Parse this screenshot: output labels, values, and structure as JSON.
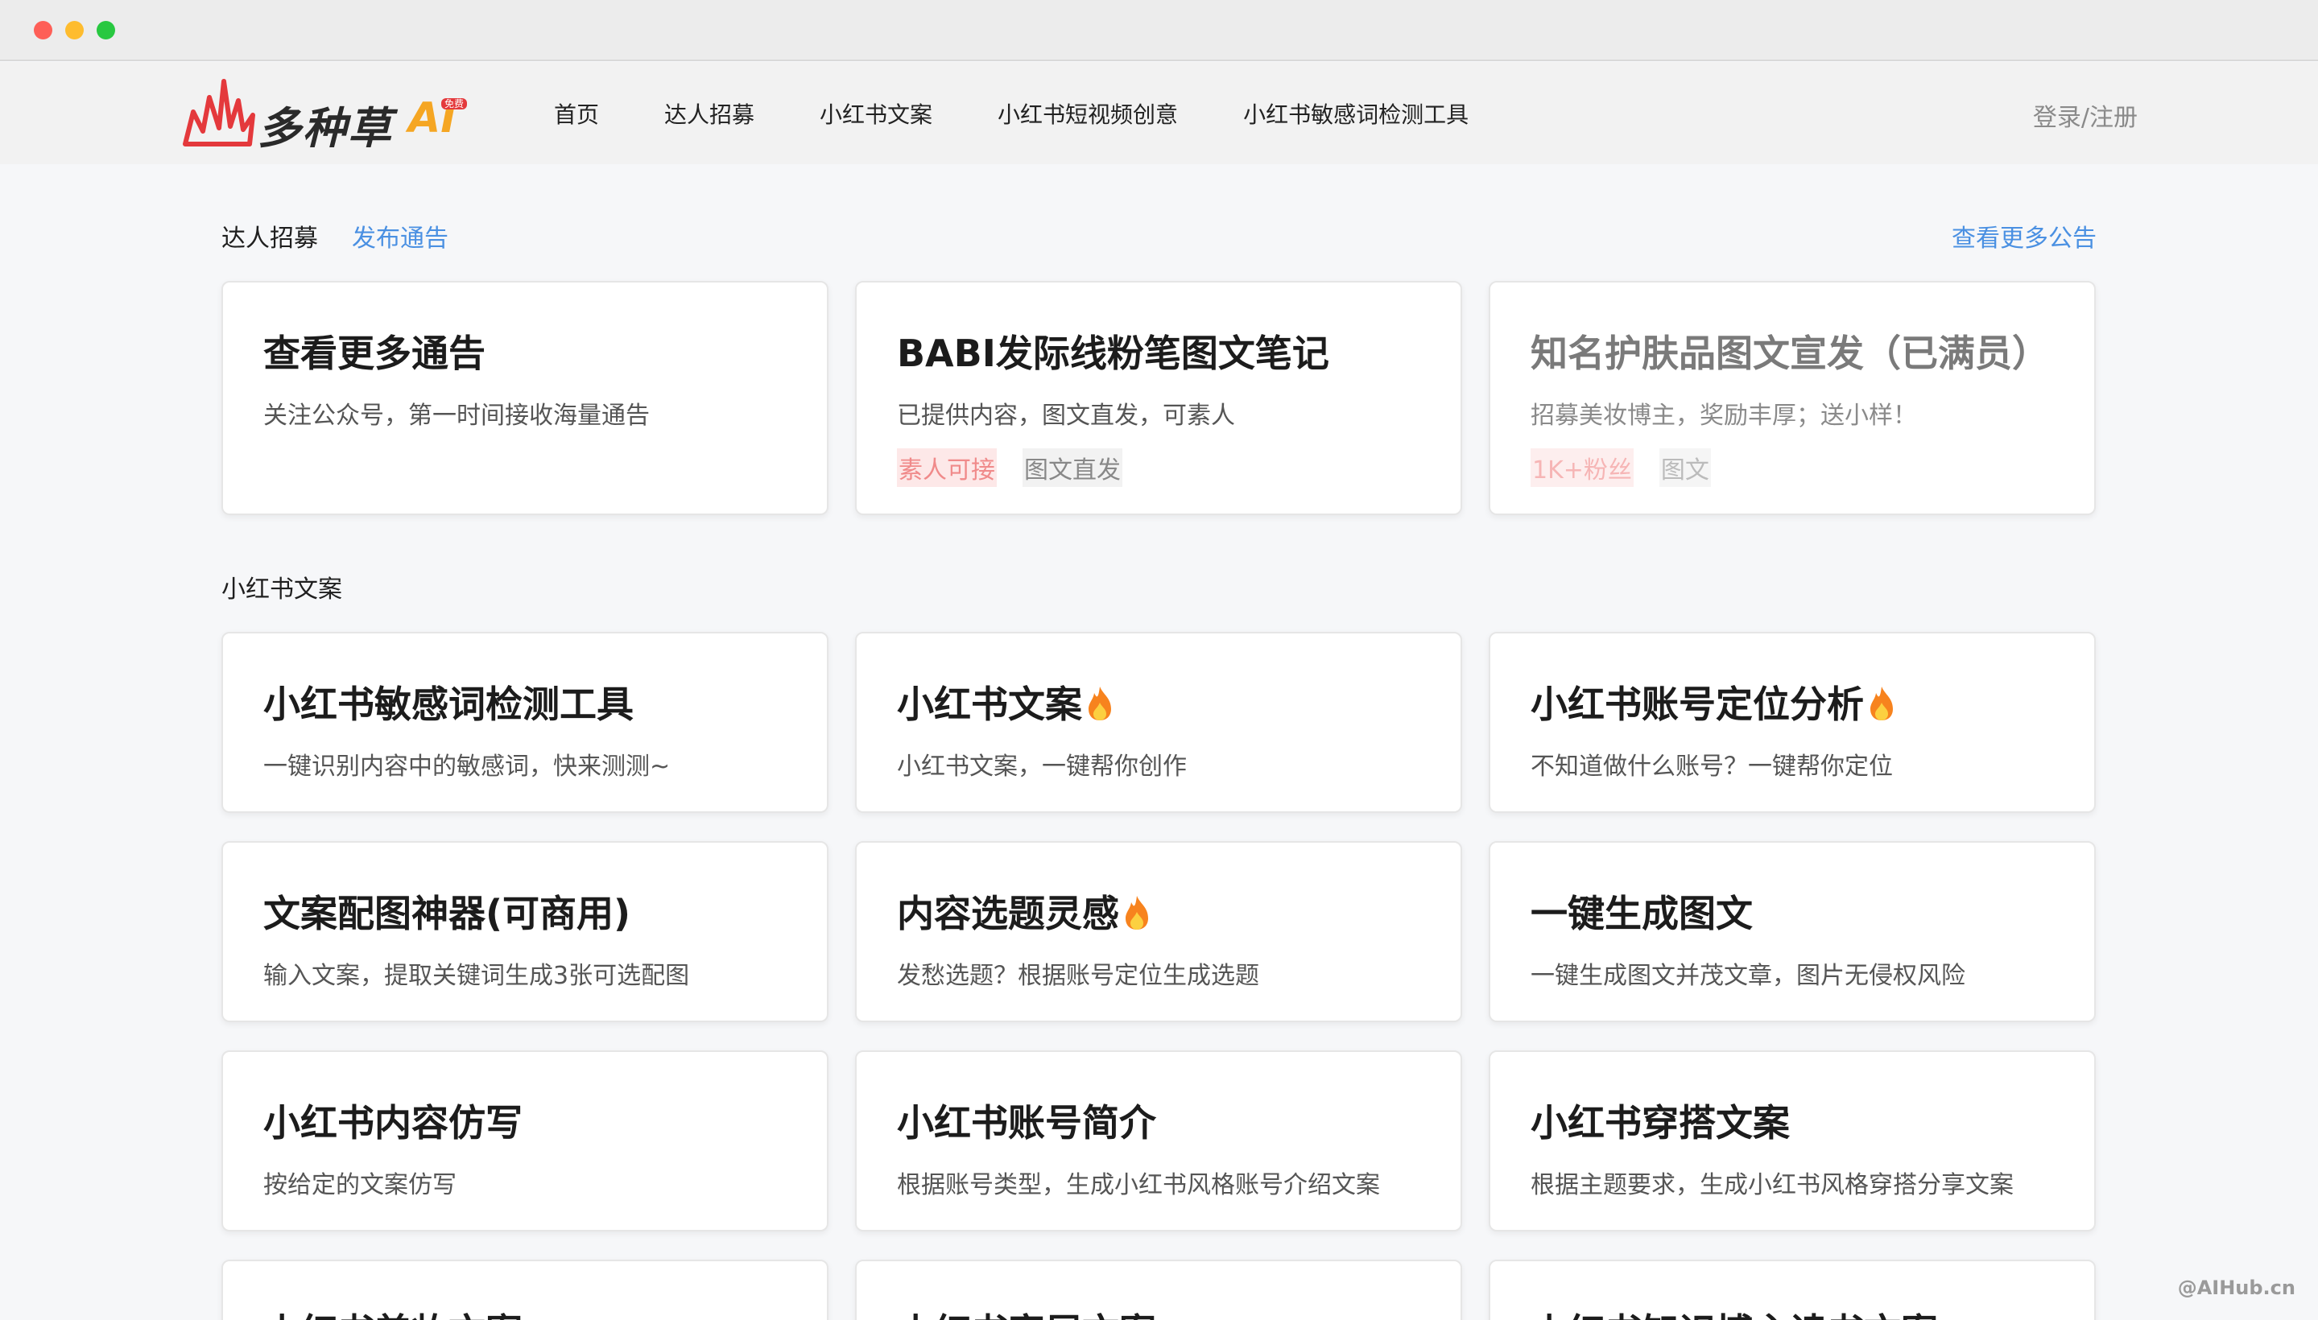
{
  "header": {
    "logo_text": "多种草",
    "logo_ai": "AI",
    "logo_badge": "免费",
    "nav": [
      "首页",
      "达人招募",
      "小红书文案",
      "小红书短视频创意",
      "小红书敏感词检测工具"
    ],
    "login": "登录/注册"
  },
  "recruit": {
    "title": "达人招募",
    "publish_link": "发布通告",
    "more_link": "查看更多公告",
    "cards": [
      {
        "title": "查看更多通告",
        "desc": "关注公众号，第一时间接收海量通告",
        "tags": []
      },
      {
        "title": "BABI发际线粉笔图文笔记",
        "desc": "已提供内容，图文直发，可素人",
        "tags": [
          "素人可接",
          "图文直发"
        ]
      },
      {
        "title": "知名护肤品图文宣发（已满员）",
        "desc": "招募美妆博主，奖励丰厚；送小样！",
        "tags": [
          "1K+粉丝",
          "图文"
        ]
      }
    ]
  },
  "copy": {
    "title": "小红书文案",
    "cards": [
      {
        "title": "小红书敏感词检测工具",
        "desc": "一键识别内容中的敏感词，快来测测~",
        "hot": false
      },
      {
        "title": "小红书文案",
        "desc": "小红书文案，一键帮你创作",
        "hot": true
      },
      {
        "title": "小红书账号定位分析",
        "desc": "不知道做什么账号？一键帮你定位",
        "hot": true
      },
      {
        "title": "文案配图神器(可商用)",
        "desc": "输入文案，提取关键词生成3张可选配图",
        "hot": false
      },
      {
        "title": "内容选题灵感",
        "desc": "发愁选题？根据账号定位生成选题",
        "hot": true
      },
      {
        "title": "一键生成图文",
        "desc": "一键生成图文并茂文章，图片无侵权风险",
        "hot": false
      },
      {
        "title": "小红书内容仿写",
        "desc": "按给定的文案仿写",
        "hot": false
      },
      {
        "title": "小红书账号简介",
        "desc": "根据账号类型，生成小红书风格账号介绍文案",
        "hot": false
      },
      {
        "title": "小红书穿搭文案",
        "desc": "根据主题要求，生成小红书风格穿搭分享文案",
        "hot": false
      },
      {
        "title": "小红书美妆文案",
        "desc": "",
        "hot": false
      },
      {
        "title": "小红书家居文案",
        "desc": "",
        "hot": false
      },
      {
        "title": "小红书知识博主读书文案",
        "desc": "",
        "hot": false
      }
    ]
  },
  "watermark": "@AIHub.cn"
}
